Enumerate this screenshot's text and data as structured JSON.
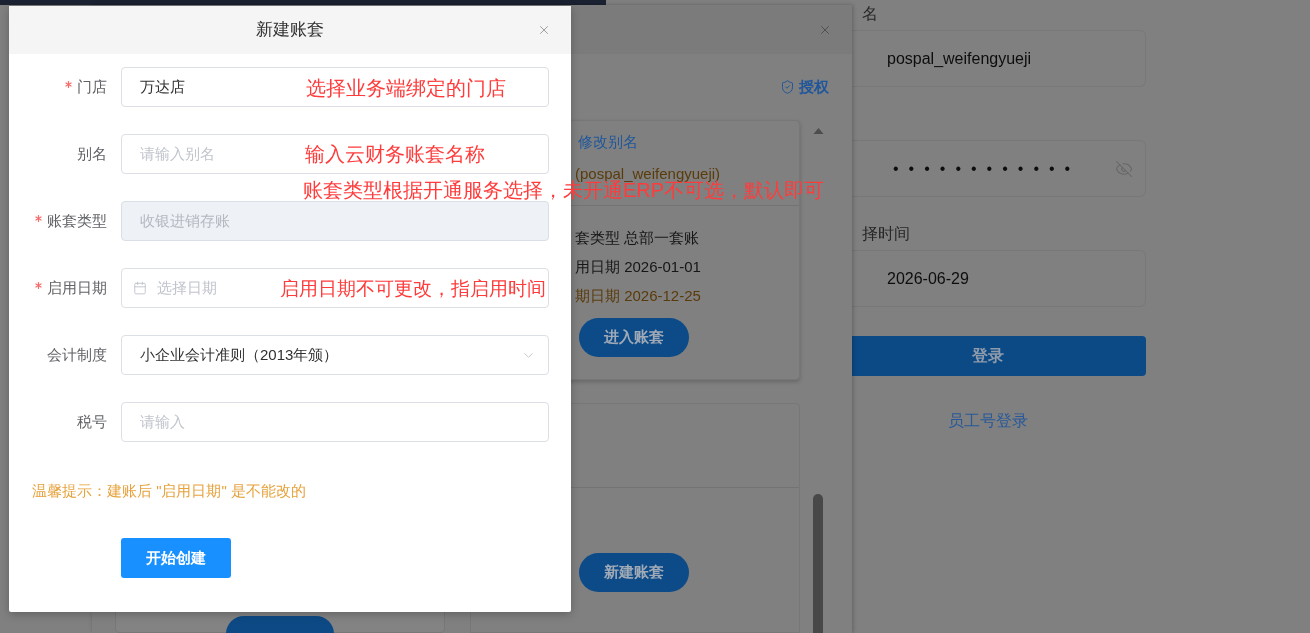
{
  "modal": {
    "title": "新建账套",
    "fields": [
      {
        "kind": "text",
        "label": "门店",
        "required": true,
        "disabled": false,
        "value": "万达店",
        "annotation": "选择业务端绑定的门店"
      },
      {
        "kind": "text",
        "label": "别名",
        "required": false,
        "disabled": false,
        "placeholder": "请输入别名",
        "annotation": "输入云财务账套名称"
      },
      {
        "kind": "text",
        "label": "账套类型",
        "required": true,
        "disabled": true,
        "value": "收银进销存账",
        "annotation": "账套类型根据开通服务选择，未开通ERP不可选，默认即可"
      },
      {
        "kind": "date",
        "label": "启用日期",
        "required": true,
        "disabled": false,
        "placeholder": "选择日期",
        "annotation": "启用日期不可更改，指启用时间"
      },
      {
        "kind": "select",
        "label": "会计制度",
        "required": false,
        "disabled": false,
        "value": "小企业会计准则（2013年颁）"
      },
      {
        "kind": "text",
        "label": "税号",
        "required": false,
        "disabled": false,
        "placeholder": "请输入"
      }
    ],
    "tip": "温馨提示：建账后 \"启用日期\" 是不能改的",
    "submit": "开始创建"
  },
  "account_sets_dialog": {
    "authorize": "授权",
    "cards": [
      {
        "rename": "修改别名",
        "account": "(pospal_weifengyueji)",
        "details": [
          {
            "text": "套类型 总部一套账",
            "warning": false
          },
          {
            "text": "用日期 2026-01-01",
            "warning": false
          },
          {
            "text": "期日期 2026-12-25",
            "warning": true
          }
        ],
        "button": "进入账套"
      },
      {
        "button": "新建账套"
      }
    ]
  },
  "login": {
    "username_label": "名",
    "username": "pospal_weifengyueji",
    "password": "••••••••••••",
    "date_label": "择时间",
    "date": "2026-06-29",
    "submit": "登录",
    "staff_login": "员工号登录"
  }
}
